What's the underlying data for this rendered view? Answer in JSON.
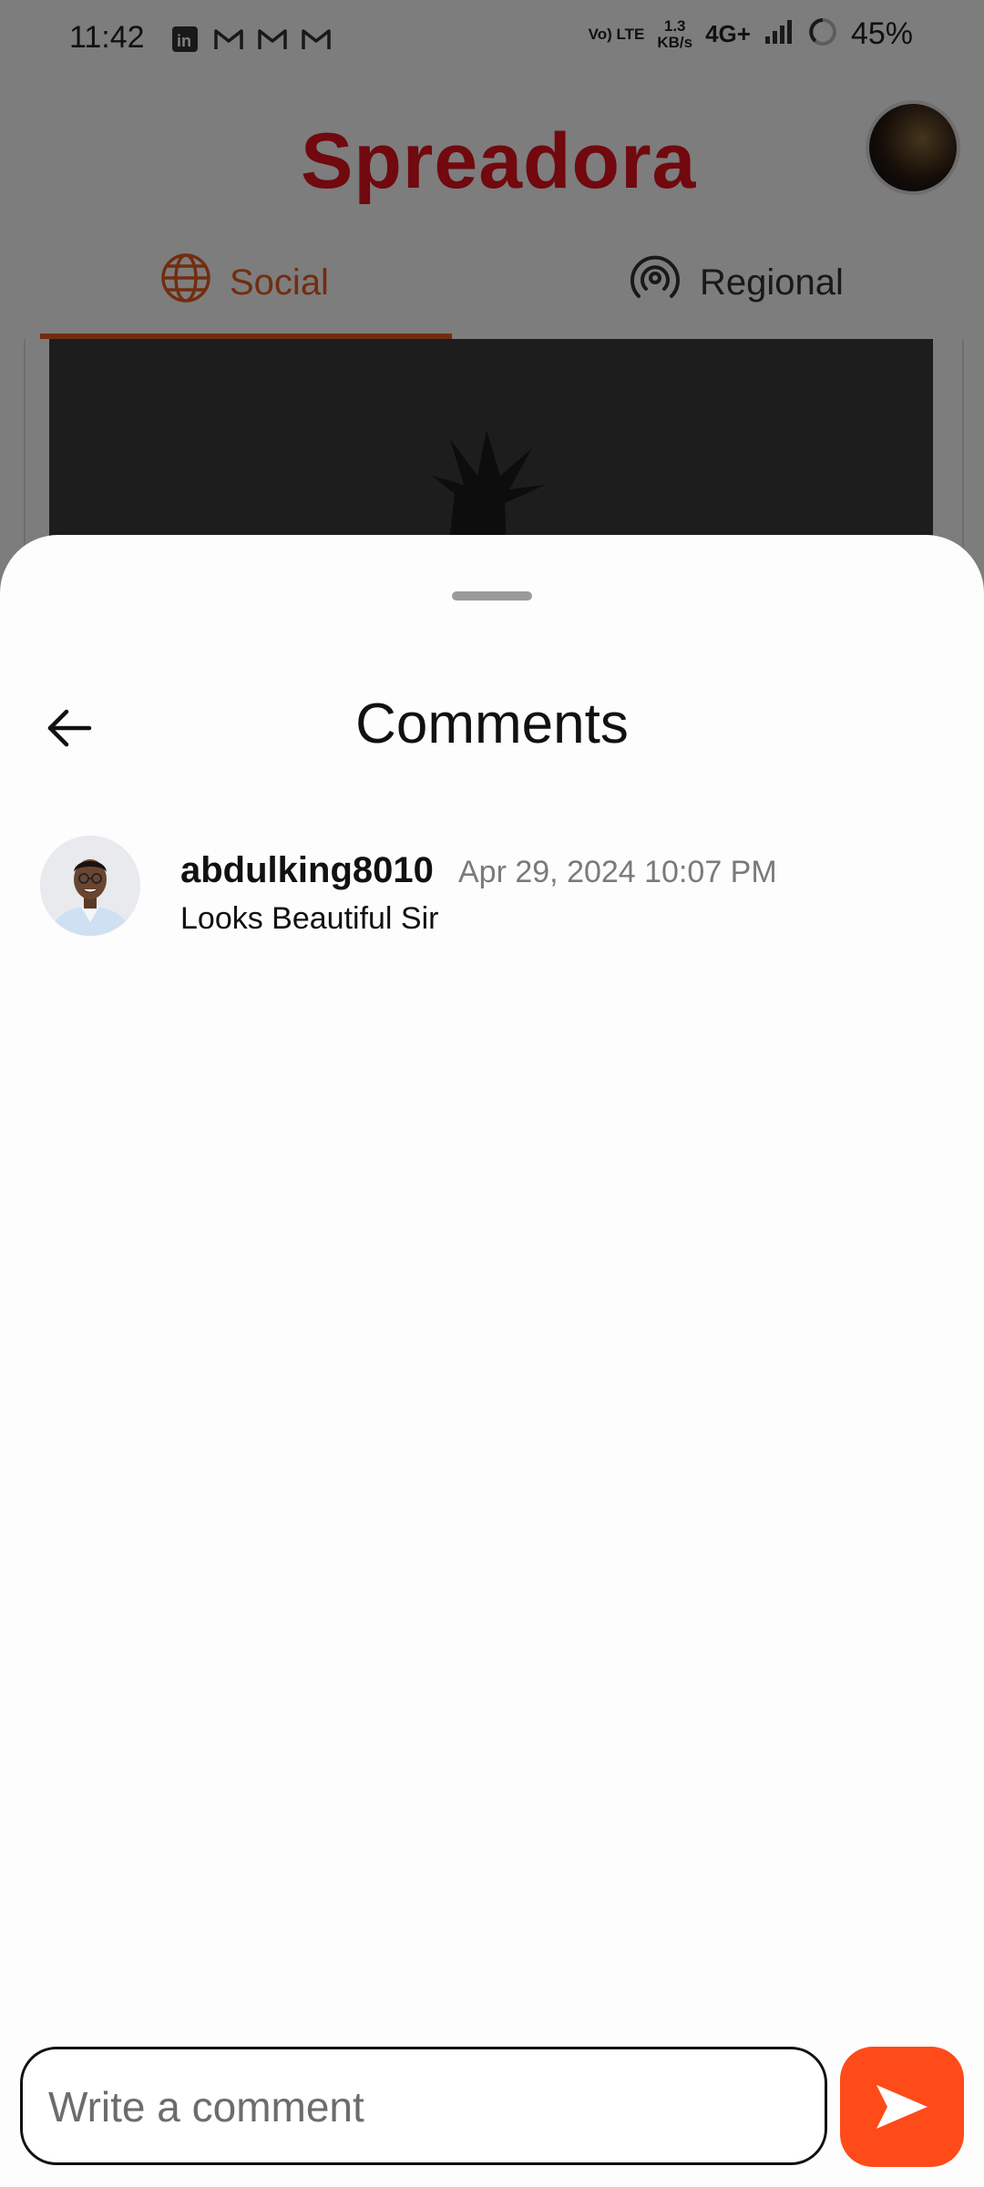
{
  "status_bar": {
    "time": "11:42",
    "app_icons": [
      "linkedin-icon",
      "gmail-icon",
      "gmail-icon",
      "gmail-icon"
    ],
    "volte": "Vo) LTE",
    "speed_value": "1.3",
    "speed_unit": "KB/s",
    "network": "4G+",
    "battery": "45%"
  },
  "header": {
    "logo_text": "Spreadora",
    "brand_color": "#e3121f"
  },
  "tabs": [
    {
      "label": "Social",
      "icon": "globe-icon",
      "active": true
    },
    {
      "label": "Regional",
      "icon": "broadcast-icon",
      "active": false
    }
  ],
  "accent_color": "#e55a1f",
  "sheet": {
    "title": "Comments",
    "comments": [
      {
        "username": "abdulking8010",
        "timestamp": "Apr 29, 2024 10:07 PM",
        "text": "Looks Beautiful Sir"
      }
    ]
  },
  "composer": {
    "placeholder": "Write a comment",
    "value": "",
    "send_color": "#ff4a1a"
  }
}
